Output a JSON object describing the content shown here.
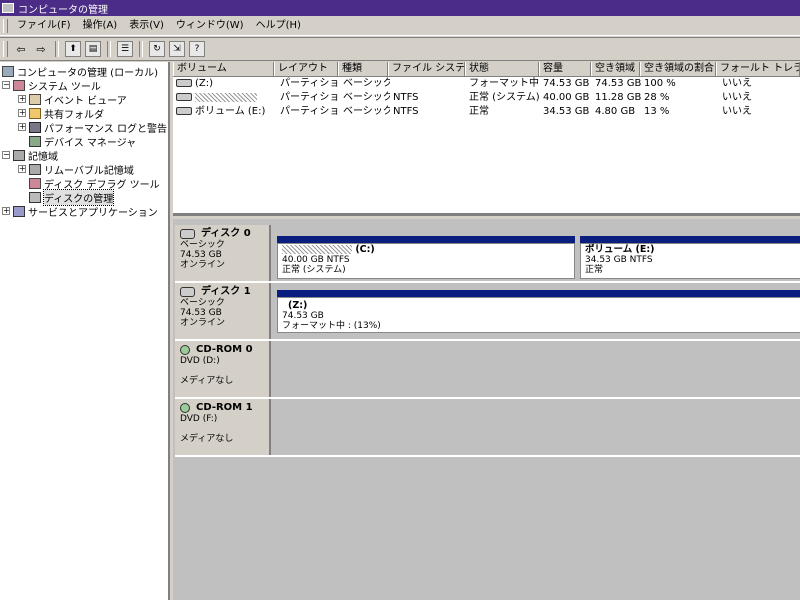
{
  "window": {
    "title": "コンピュータの管理"
  },
  "menu": [
    "ファイル(F)",
    "操作(A)",
    "表示(V)",
    "ウィンドウ(W)",
    "ヘルプ(H)"
  ],
  "toolbar": {
    "back": "⇦",
    "forward": "⇨",
    "icons": [
      "up-folder-icon",
      "show-tree-icon",
      "properties-icon",
      "refresh-icon",
      "export-icon",
      "help-icon"
    ]
  },
  "tree": {
    "root": "コンピュータの管理 (ローカル)",
    "system_tools": "システム ツール",
    "event_viewer": "イベント ビューア",
    "shared_folders": "共有フォルダ",
    "perf_logs": "パフォーマンス ログと警告",
    "device_manager": "デバイス マネージャ",
    "storage": "記憶域",
    "removable": "リムーバブル記憶域",
    "defrag": "ディスク デフラグ ツール",
    "disk_mgmt": "ディスクの管理",
    "services": "サービスとアプリケーション",
    "expand_plus": "+",
    "expand_minus": "−"
  },
  "columns": [
    "ボリューム",
    "レイアウト",
    "種類",
    "ファイル システム",
    "状態",
    "容量",
    "空き領域",
    "空き領域の割合",
    "フォールト トレランス"
  ],
  "volumes": [
    {
      "name": "(Z:)",
      "layout": "パーティション",
      "type": "ベーシック",
      "fs": "",
      "status": "フォーマット中 :",
      "capacity": "74.53 GB",
      "free": "74.53 GB",
      "pct": "100 %",
      "ft": "いいえ"
    },
    {
      "name": "",
      "layout": "パーティション",
      "type": "ベーシック",
      "fs": "NTFS",
      "status": "正常 (システム)",
      "capacity": "40.00 GB",
      "free": "11.28 GB",
      "pct": "28 %",
      "ft": "いいえ"
    },
    {
      "name": "ボリューム (E:)",
      "layout": "パーティション",
      "type": "ベーシック",
      "fs": "NTFS",
      "status": "正常",
      "capacity": "34.53 GB",
      "free": "4.80 GB",
      "pct": "13 %",
      "ft": "いいえ"
    }
  ],
  "disks": {
    "disk0": {
      "name": "ディスク 0",
      "kind": "ベーシック",
      "size": "74.53 GB",
      "state": "オンライン",
      "p1_letter": "(C:)",
      "p1_size": "40.00 GB NTFS",
      "p1_status": "正常 (システム)",
      "p2_name": "ボリューム (E:)",
      "p2_size": "34.53 GB NTFS",
      "p2_status": "正常"
    },
    "disk1": {
      "name": "ディスク 1",
      "kind": "ベーシック",
      "size": "74.53 GB",
      "state": "オンライン",
      "p1_name": "(Z:)",
      "p1_size": "74.53 GB",
      "p1_status": "フォーマット中 : (13%)"
    },
    "cd0": {
      "name": "CD-ROM 0",
      "drive": "DVD (D:)",
      "media": "メディアなし"
    },
    "cd1": {
      "name": "CD-ROM 1",
      "drive": "DVD (F:)",
      "media": "メディアなし"
    }
  },
  "colors": {
    "titlebar": "#4b2c86",
    "partition_bar": "#0a1e80",
    "face": "#d4d0c8"
  }
}
